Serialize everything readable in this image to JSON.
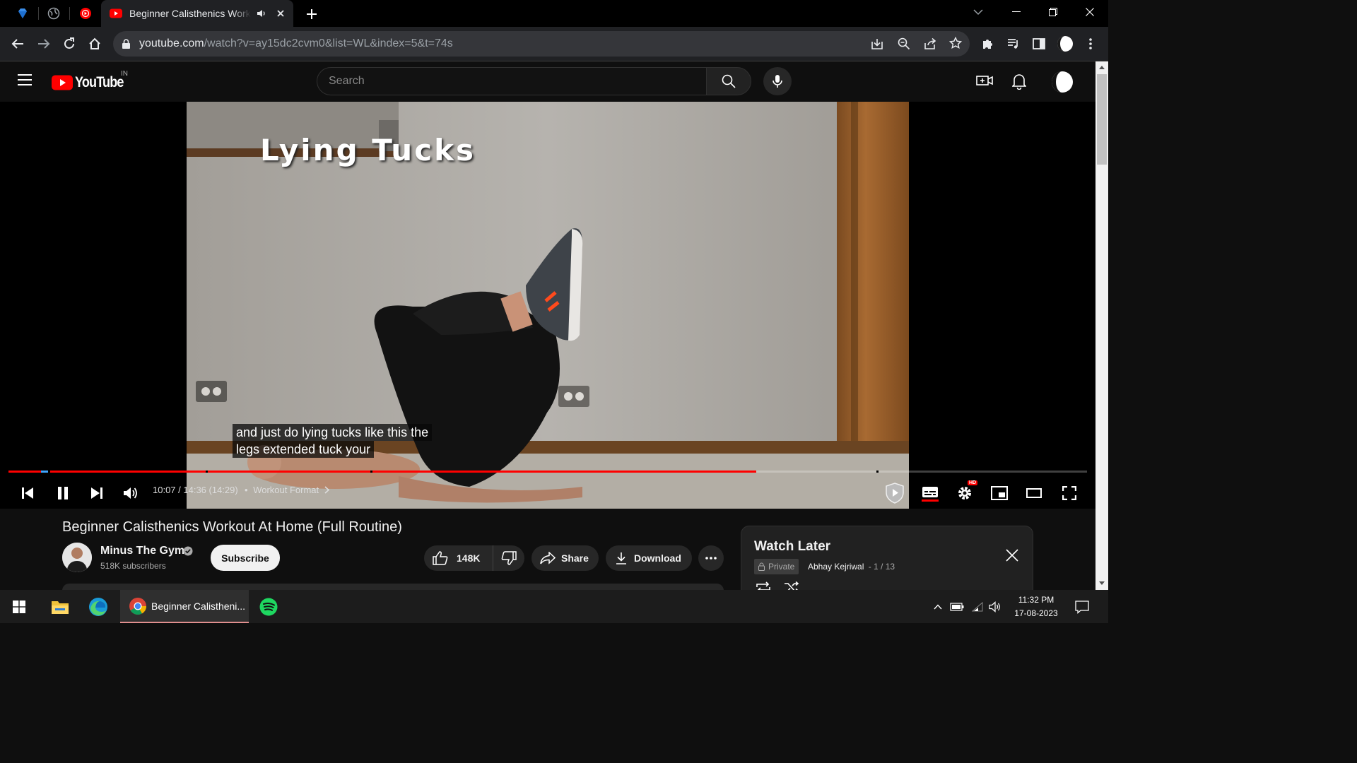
{
  "browser": {
    "active_tab_title": "Beginner Calisthenics Workout At Home (Full Routine)",
    "url_host": "youtube.com",
    "url_path": "/watch?v=ay15dc2cvm0&list=WL&index=5&t=74s"
  },
  "youtube": {
    "logo_text": "YouTube",
    "country_code": "IN",
    "search_placeholder": "Search"
  },
  "video": {
    "overlay_text": "Lying Tucks",
    "caption_line1": "and just do lying tucks like this the",
    "caption_line2": "legs extended tuck your",
    "time_display": "10:07 / 14:36 (14:29)",
    "chapter_separator": "•",
    "chapter": "Workout Format",
    "progress_fraction": 0.693,
    "hd_badge": "HD",
    "title": "Beginner Calisthenics Workout At Home (Full Routine)"
  },
  "channel": {
    "name": "Minus The Gym",
    "subscribers": "518K subscribers",
    "subscribe_label": "Subscribe"
  },
  "actions": {
    "likes": "148K",
    "share_label": "Share",
    "download_label": "Download"
  },
  "watch_later": {
    "title": "Watch Later",
    "privacy": "Private",
    "owner": "Abhay Kejriwal",
    "position": "- 1 / 13"
  },
  "taskbar": {
    "chrome_label": "Beginner Calistheni...",
    "time": "11:32 PM",
    "date": "17-08-2023"
  },
  "colors": {
    "accent_red": "#ff0000",
    "background": "#0f0f0f"
  }
}
